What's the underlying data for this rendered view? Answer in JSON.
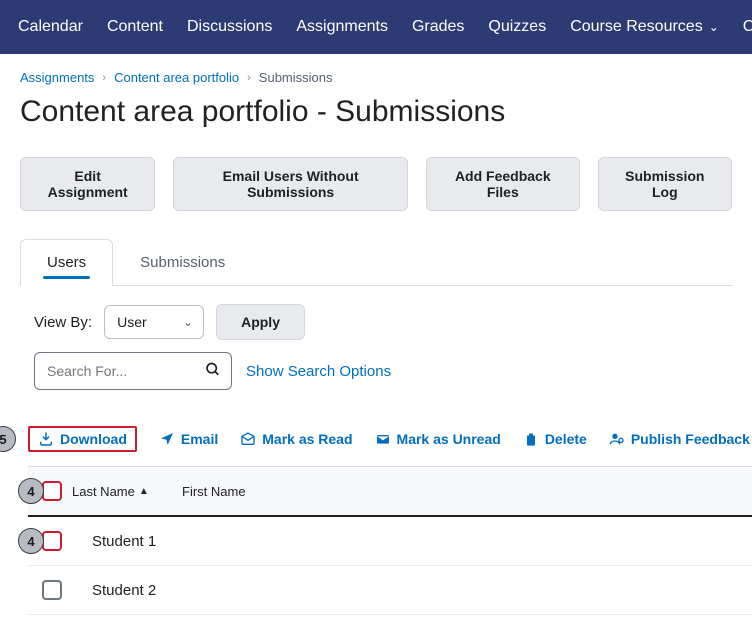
{
  "nav": {
    "items": [
      "Calendar",
      "Content",
      "Discussions",
      "Assignments",
      "Grades",
      "Quizzes",
      "Course Resources",
      "Cou"
    ]
  },
  "breadcrumb": {
    "assignments": "Assignments",
    "portfolio": "Content area portfolio",
    "current": "Submissions"
  },
  "page_title": "Content area portfolio - Submissions",
  "actions": {
    "edit": "Edit Assignment",
    "email_no_sub": "Email Users Without Submissions",
    "add_feedback": "Add Feedback Files",
    "sub_log": "Submission Log"
  },
  "tabs": {
    "users": "Users",
    "submissions": "Submissions"
  },
  "filter": {
    "label": "View By:",
    "selected": "User",
    "apply": "Apply"
  },
  "search": {
    "placeholder": "Search For...",
    "show_options": "Show Search Options"
  },
  "bulk": {
    "download": "Download",
    "email": "Email",
    "mark_read": "Mark as Read",
    "mark_unread": "Mark as Unread",
    "delete": "Delete",
    "publish": "Publish Feedback"
  },
  "table": {
    "col_last": "Last Name",
    "col_first": "First Name",
    "rows": [
      "Student 1",
      "Student 2"
    ]
  },
  "markers": {
    "m5": "5",
    "m4a": "4",
    "m4b": "4"
  }
}
